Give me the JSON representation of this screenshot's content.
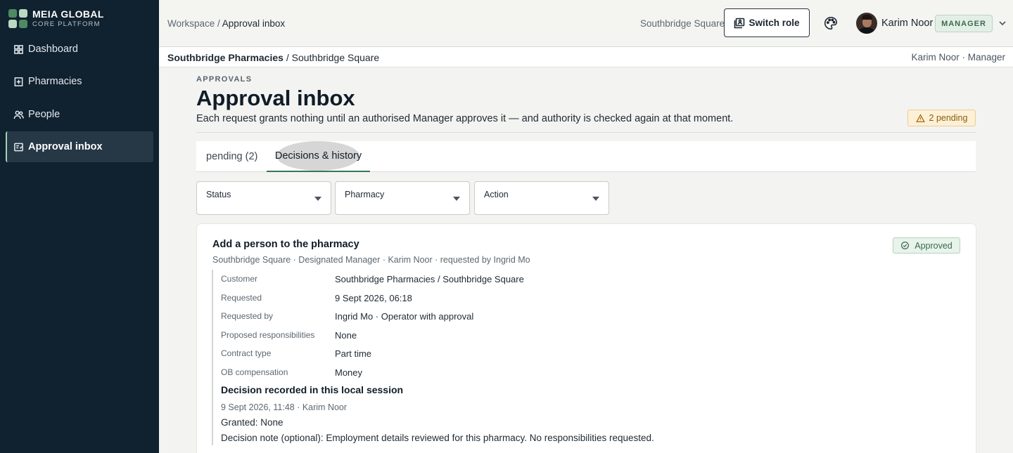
{
  "brand": {
    "title": "MEIA GLOBAL",
    "subtitle": "CORE PLATFORM"
  },
  "sidebar": {
    "items": [
      {
        "label": "Dashboard",
        "icon": "grid-icon"
      },
      {
        "label": "Pharmacies",
        "icon": "building-icon"
      },
      {
        "label": "People",
        "icon": "people-icon"
      },
      {
        "label": "Approval inbox",
        "icon": "inbox-icon",
        "active": true
      }
    ]
  },
  "header": {
    "breadcrumb_root": "Workspace",
    "breadcrumb_sep": " / ",
    "breadcrumb_current": "Approval inbox",
    "site": "Southbridge Square",
    "switch_role_label": "Switch role",
    "user_name": "Karim Noor",
    "role": "MANAGER"
  },
  "context": {
    "customer": "Southbridge Pharmacies",
    "sep": " / ",
    "site": "Southbridge Square",
    "user_role": "Karim Noor · Manager"
  },
  "page": {
    "eyebrow": "APPROVALS",
    "title": "Approval inbox",
    "description": "Each request grants nothing until an authorised Manager approves it — and authority is checked again at that moment.",
    "pending_badge": "2 pending"
  },
  "tabs": [
    {
      "label": "pending (2)"
    },
    {
      "label": "Decisions & history",
      "active": true
    }
  ],
  "filters": [
    {
      "label": "Status"
    },
    {
      "label": "Pharmacy"
    },
    {
      "label": "Action"
    }
  ],
  "request": {
    "title": "Add a person to the pharmacy",
    "subtitle": "Southbridge Square · Designated Manager · Karim Noor · requested by Ingrid Mo",
    "status": "Approved",
    "fields": [
      {
        "label": "Customer",
        "value": "Southbridge Pharmacies / Southbridge Square"
      },
      {
        "label": "Requested",
        "value": "9 Sept 2026, 06:18"
      },
      {
        "label": "Requested by",
        "value": "Ingrid Mo · Operator with approval"
      },
      {
        "label": "Proposed responsibilities",
        "value": "None"
      },
      {
        "label": "Contract type",
        "value": "Part time"
      },
      {
        "label": "OB compensation",
        "value": "Money"
      }
    ],
    "decision": {
      "title": "Decision recorded in this local session",
      "meta": "9 Sept 2026, 11:48 · Karim Noor",
      "granted": "Granted: None",
      "note": "Decision note (optional): Employment details reviewed for this pharmacy. No responsibilities requested."
    }
  },
  "colors": {
    "sidebar_bg": "#10212f",
    "accent_green": "#3a7457",
    "pending_bg": "#fdf0d6",
    "approved_bg": "#e8f3eb"
  }
}
